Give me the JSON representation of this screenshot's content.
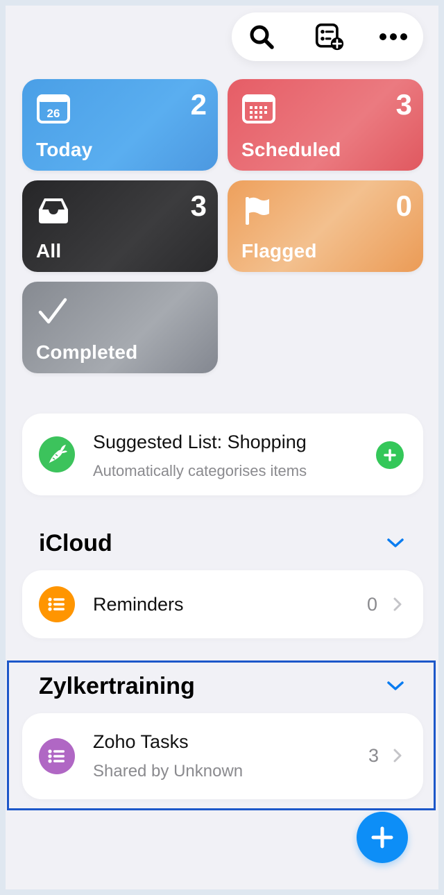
{
  "toolbar": {
    "search_icon": "search-icon",
    "new_list_icon": "list-add-icon",
    "more_icon": "ellipsis-icon"
  },
  "smart_lists": [
    {
      "label": "Today",
      "count": "2",
      "icon": "calendar-26-icon",
      "icon_text": "26",
      "color": "#4a9fe6"
    },
    {
      "label": "Scheduled",
      "count": "3",
      "icon": "calendar-icon",
      "color": "#e65d66"
    },
    {
      "label": "All",
      "count": "3",
      "icon": "tray-icon",
      "color": "#2c2c2e"
    },
    {
      "label": "Flagged",
      "count": "0",
      "icon": "flag-icon",
      "color": "#f0a868"
    },
    {
      "label": "Completed",
      "icon": "checkmark-icon",
      "color": "#8e9298"
    }
  ],
  "suggestion": {
    "title": "Suggested List: Shopping",
    "subtitle": "Automatically categorises items",
    "icon": "carrot-icon"
  },
  "sections": [
    {
      "title": "iCloud",
      "lists": [
        {
          "title": "Reminders",
          "count": "0",
          "icon": "list-bullet-icon",
          "color": "#ff9500"
        }
      ]
    },
    {
      "title": "Zylkertraining",
      "lists": [
        {
          "title": "Zoho Tasks",
          "subtitle": "Shared by Unknown",
          "count": "3",
          "icon": "list-bullet-icon",
          "color": "#b067c4"
        }
      ]
    }
  ],
  "accent_color": "#0d8ef7",
  "highlight_color": "#1c57c9"
}
